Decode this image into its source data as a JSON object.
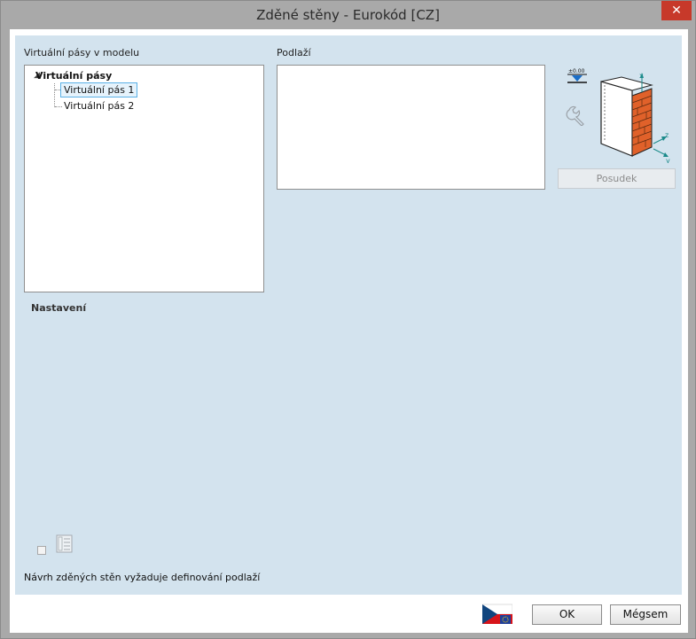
{
  "window": {
    "title": "Zděné stěny - Eurokód [CZ]",
    "close_glyph": "✕"
  },
  "left": {
    "label": "Virtuální pásy v modelu",
    "tree": {
      "toggle": "◢",
      "root": "Virtuální pásy",
      "items": [
        "Virtuální pás 1",
        "Virtuální pás 2"
      ]
    }
  },
  "right": {
    "label": "Podlaží",
    "level_icon_text": "±0.00",
    "axes": {
      "x": "x",
      "y": "y",
      "z": "z"
    },
    "check_button": "Posudek"
  },
  "settings": {
    "heading": "Nastavení"
  },
  "status_message": "Návrh zděných stěn vyžaduje definování podlaží",
  "footer": {
    "ok": "OK",
    "cancel": "Mégsem"
  },
  "colors": {
    "panel": "#d3e3ee",
    "brick": "#e0612a",
    "accent": "#5ab0e6"
  }
}
